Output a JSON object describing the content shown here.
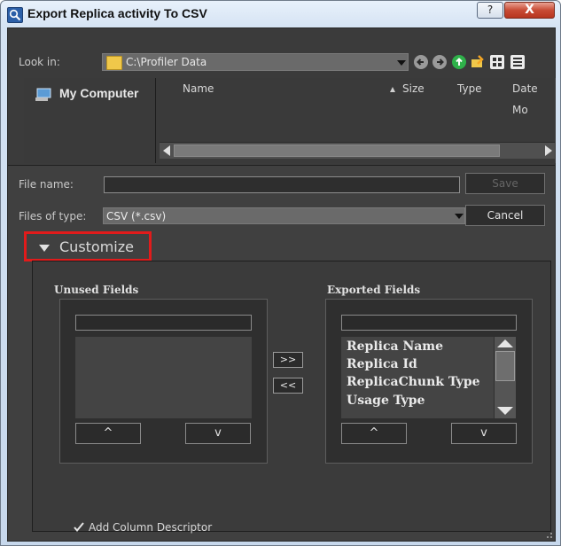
{
  "window": {
    "title": "Export Replica activity To CSV",
    "help_label": "?",
    "close_label": "X"
  },
  "look_in": {
    "label": "Look in:",
    "value": "C:\\Profiler Data"
  },
  "places": {
    "my_computer": "My Computer"
  },
  "file_list": {
    "columns": [
      "Name",
      "Size",
      "Type",
      "Date Mo"
    ]
  },
  "file_name": {
    "label": "File name:",
    "value": "",
    "save_label": "Save"
  },
  "file_type": {
    "label": "Files of type:",
    "value": "CSV (*.csv)",
    "cancel_label": "Cancel"
  },
  "customize": {
    "label": "Customize",
    "unused_title": "Unused Fields",
    "exported_title": "Exported Fields",
    "unused_items": [],
    "exported_items": [
      "Replica Name",
      "Replica Id",
      "ReplicaChunk Type",
      "Usage Type"
    ],
    "move_right_label": ">>",
    "move_left_label": "<<",
    "up_label": "^",
    "down_label": "v",
    "add_column_descriptor_label": "Add Column Descriptor",
    "add_column_descriptor_checked": true
  },
  "colors": {
    "highlight_border": "#e11b1b",
    "client_bg": "#404040"
  }
}
